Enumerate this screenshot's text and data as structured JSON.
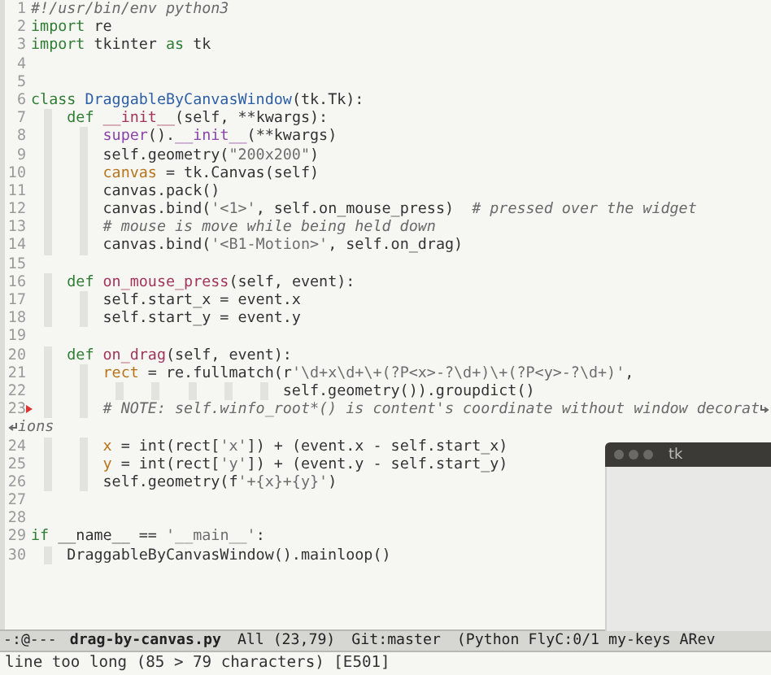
{
  "editor": {
    "lines": [
      {
        "number": "1",
        "error": false,
        "tokens": [
          {
            "kind": "comment",
            "text": "#!/usr/bin/env python3"
          }
        ]
      },
      {
        "number": "2",
        "error": false,
        "tokens": [
          {
            "kind": "keyword",
            "text": "import"
          },
          {
            "kind": "plain",
            "text": " re"
          }
        ]
      },
      {
        "number": "3",
        "error": false,
        "tokens": [
          {
            "kind": "keyword",
            "text": "import"
          },
          {
            "kind": "plain",
            "text": " tkinter "
          },
          {
            "kind": "keyword",
            "text": "as"
          },
          {
            "kind": "plain",
            "text": " tk"
          }
        ]
      },
      {
        "number": "4",
        "error": false
      },
      {
        "number": "5",
        "error": false
      },
      {
        "number": "6",
        "error": false,
        "tokens": [
          {
            "kind": "keyword",
            "text": "class"
          },
          {
            "kind": "type",
            "text": " DraggableByCanvasWindow"
          },
          {
            "kind": "plain",
            "text": "(tk.Tk):"
          }
        ]
      },
      {
        "number": "7",
        "error": false,
        "tokens": [
          {
            "kind": "keyword",
            "text": "    def"
          },
          {
            "kind": "function",
            "text": " __init__"
          },
          {
            "kind": "plain",
            "text": "(self, **kwargs):"
          }
        ]
      },
      {
        "number": "8",
        "error": false,
        "tokens": [
          {
            "kind": "builtin",
            "text": "        super"
          },
          {
            "kind": "plain",
            "text": "()."
          },
          {
            "kind": "builtin",
            "text": "__init__"
          },
          {
            "kind": "plain",
            "text": "(**kwargs)"
          }
        ]
      },
      {
        "number": "9",
        "error": false,
        "tokens": [
          {
            "kind": "plain",
            "text": "        self.geometry("
          },
          {
            "kind": "string",
            "text": "\"200x200\""
          },
          {
            "kind": "plain",
            "text": ")"
          }
        ]
      },
      {
        "number": "10",
        "error": false,
        "tokens": [
          {
            "kind": "variable",
            "text": "        canvas"
          },
          {
            "kind": "plain",
            "text": " = tk.Canvas(self)"
          }
        ]
      },
      {
        "number": "11",
        "error": false,
        "tokens": [
          {
            "kind": "plain",
            "text": "        canvas.pack()"
          }
        ]
      },
      {
        "number": "12",
        "error": false,
        "tokens": [
          {
            "kind": "plain",
            "text": "        canvas.bind("
          },
          {
            "kind": "string",
            "text": "'<1>'"
          },
          {
            "kind": "plain",
            "text": ", self.on_mouse_press)  "
          },
          {
            "kind": "comment",
            "text": "# pressed over the widget"
          }
        ]
      },
      {
        "number": "13",
        "error": false,
        "tokens": [
          {
            "kind": "comment",
            "text": "        # mouse is move while being held down"
          }
        ]
      },
      {
        "number": "14",
        "error": false,
        "tokens": [
          {
            "kind": "plain",
            "text": "        canvas.bind("
          },
          {
            "kind": "string",
            "text": "'<B1-Motion>'"
          },
          {
            "kind": "plain",
            "text": ", self.on_drag)"
          }
        ]
      },
      {
        "number": "15",
        "error": false
      },
      {
        "number": "16",
        "error": false,
        "tokens": [
          {
            "kind": "keyword",
            "text": "    def"
          },
          {
            "kind": "function",
            "text": " on_mouse_press"
          },
          {
            "kind": "plain",
            "text": "(self, event):"
          }
        ]
      },
      {
        "number": "17",
        "error": false,
        "tokens": [
          {
            "kind": "plain",
            "text": "        self.start_x = event.x"
          }
        ]
      },
      {
        "number": "18",
        "error": false,
        "tokens": [
          {
            "kind": "plain",
            "text": "        self.start_y = event.y"
          }
        ]
      },
      {
        "number": "19",
        "error": false
      },
      {
        "number": "20",
        "error": false,
        "tokens": [
          {
            "kind": "keyword",
            "text": "    def"
          },
          {
            "kind": "function",
            "text": " on_drag"
          },
          {
            "kind": "plain",
            "text": "(self, event):"
          }
        ]
      },
      {
        "number": "21",
        "error": false,
        "tokens": [
          {
            "kind": "variable",
            "text": "        rect"
          },
          {
            "kind": "plain",
            "text": " = re.fullmatch(r"
          },
          {
            "kind": "string",
            "text": "'\\d+x\\d+\\+(?P<x>-?\\d+)\\+(?P<y>-?\\d+)'"
          },
          {
            "kind": "plain",
            "text": ","
          }
        ]
      },
      {
        "number": "22",
        "error": false,
        "tokens": [
          {
            "kind": "plain",
            "text": "                            self.geometry()).groupdict()"
          }
        ]
      },
      {
        "number": "23",
        "error": true,
        "tokens": [
          {
            "kind": "comment",
            "text": "        # NOTE: self.winfo_root*() is content's coordinate without window decorat"
          }
        ],
        "continuation": "ions"
      },
      {
        "number": "24",
        "error": false,
        "tokens": [
          {
            "kind": "variable",
            "text": "        x"
          },
          {
            "kind": "plain",
            "text": " = int(rect["
          },
          {
            "kind": "string",
            "text": "'x'"
          },
          {
            "kind": "plain",
            "text": "]) + (event.x - self.start_x)"
          }
        ]
      },
      {
        "number": "25",
        "error": false,
        "tokens": [
          {
            "kind": "variable",
            "text": "        y"
          },
          {
            "kind": "plain",
            "text": " = int(rect["
          },
          {
            "kind": "string",
            "text": "'y'"
          },
          {
            "kind": "plain",
            "text": "]) + (event.y - self.start_y)"
          }
        ]
      },
      {
        "number": "26",
        "error": false,
        "tokens": [
          {
            "kind": "plain",
            "text": "        self.geometry(f"
          },
          {
            "kind": "string",
            "text": "'+{x}+{y}'"
          },
          {
            "kind": "plain",
            "text": ")"
          }
        ]
      },
      {
        "number": "27",
        "error": false
      },
      {
        "number": "28",
        "error": false
      },
      {
        "number": "29",
        "error": false,
        "tokens": [
          {
            "kind": "keyword",
            "text": "if"
          },
          {
            "kind": "plain",
            "text": " __name__ == "
          },
          {
            "kind": "string",
            "text": "'__main__'"
          },
          {
            "kind": "plain",
            "text": ":"
          }
        ]
      },
      {
        "number": "30",
        "error": false,
        "tokens": [
          {
            "kind": "plain",
            "text": "    DraggableByCanvasWindow().mainloop()"
          }
        ]
      }
    ]
  },
  "floating_window": {
    "title": "tk"
  },
  "mode_line": {
    "segments": [
      {
        "text": "-:@---",
        "bold": false
      },
      {
        "text": "drag-by-canvas.py",
        "bold": true
      },
      {
        "text": "All (23,79)",
        "bold": false
      },
      {
        "text": "Git:master",
        "bold": false
      },
      {
        "text": "(Python FlyC:0/1 my-keys ARev",
        "bold": false
      }
    ]
  },
  "echo_area": {
    "message": "line too long (85 > 79 characters) [E501]"
  }
}
